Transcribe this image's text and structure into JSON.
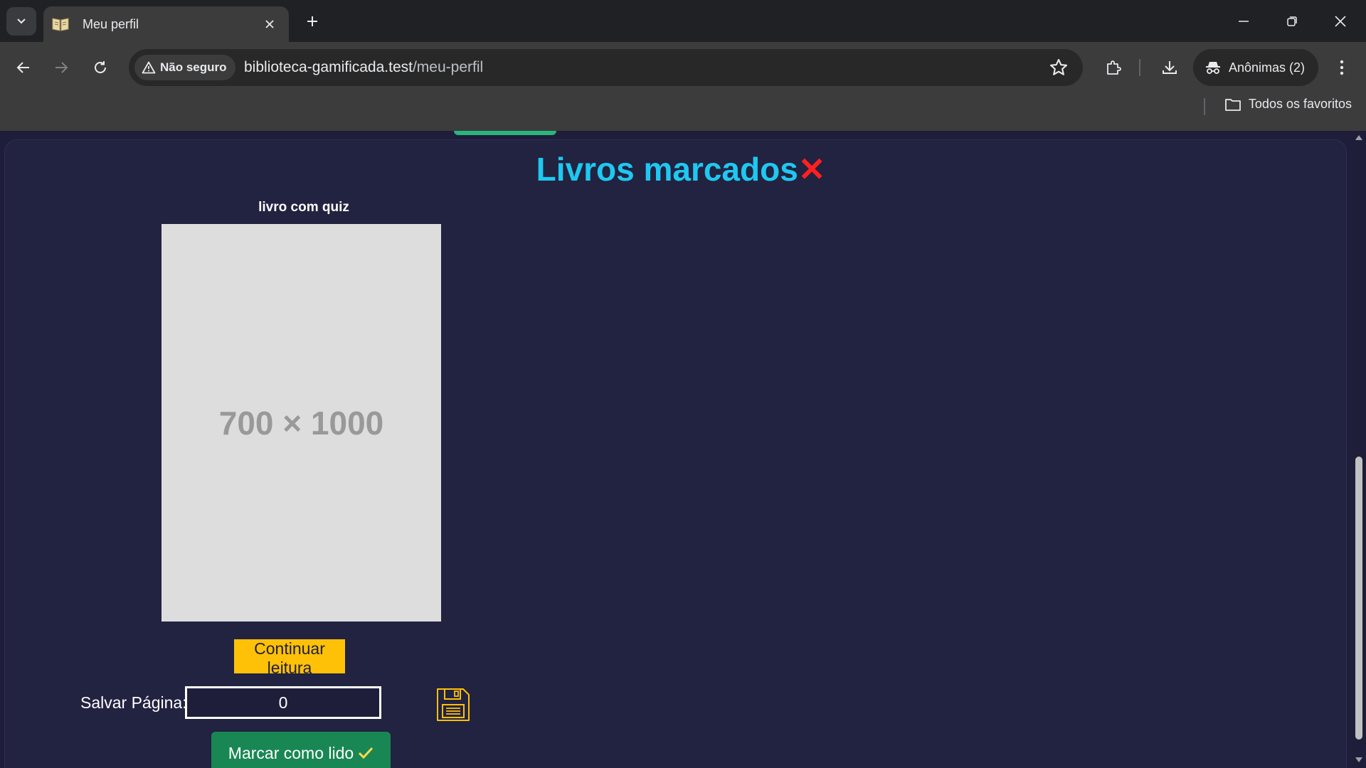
{
  "browser": {
    "tab_title": "Meu perfil",
    "security_label": "Não seguro",
    "url_host": "biblioteca-gamificada.test",
    "url_path": "/meu-perfil",
    "profile_label": "Anônimas (2)",
    "bookmarks_label": "Todos os favoritos",
    "icons": [
      "tab-search-icon",
      "book-favicon",
      "close-icon",
      "plus-icon",
      "minimize-icon",
      "restore-icon",
      "window-close-icon",
      "back-arrow-icon",
      "forward-arrow-icon",
      "reload-icon",
      "warning-icon",
      "star-icon",
      "extensions-icon",
      "download-icon",
      "incognito-icon",
      "kebab-menu-icon",
      "folder-icon"
    ]
  },
  "page": {
    "heading": "Livros marcados",
    "heading_mark": "✕",
    "book": {
      "title": "livro com quiz",
      "cover_placeholder": "700 × 1000"
    },
    "continue_label": "Continuar leitura",
    "save_page_label": "Salvar Página:",
    "page_value": "0",
    "mark_read_label": "Marcar como lido",
    "colors": {
      "heading": "#1ec8f0",
      "close_mark": "#ff2020",
      "continue_button": "#ffc107",
      "mark_read_button": "#198754",
      "background": "#222241"
    }
  }
}
